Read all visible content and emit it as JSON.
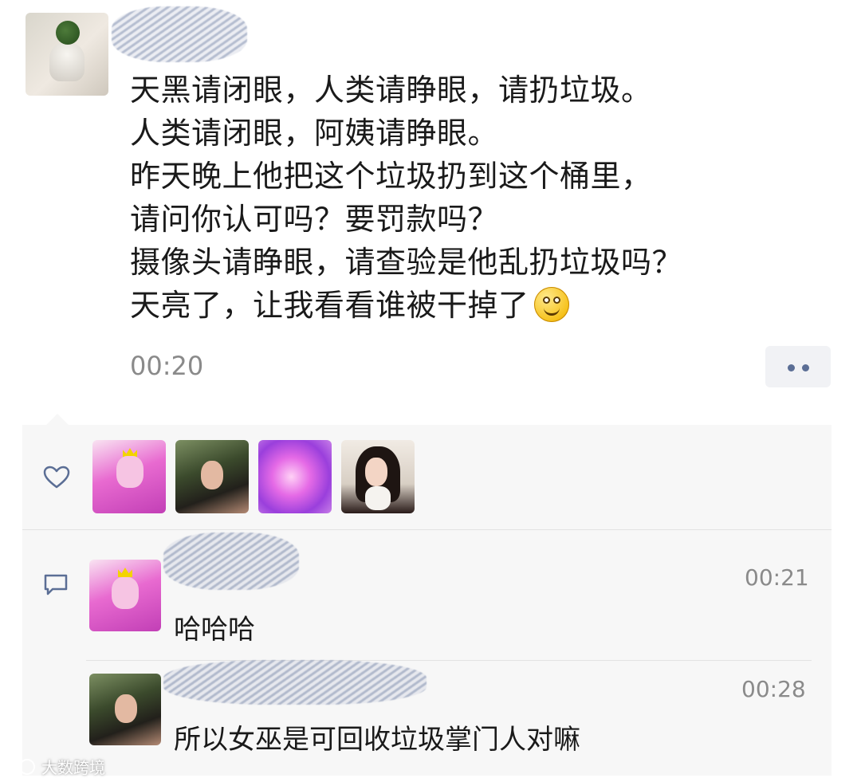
{
  "post": {
    "lines": [
      "天黑请闭眼，人类请睁眼，请扔垃圾。",
      "人类请闭眼，阿姨请睁眼。",
      "昨天晚上他把这个垃圾扔到这个桶里，",
      "请问你认可吗？要罚款吗？",
      "摄像头请睁眼，请查验是他乱扔垃圾吗？",
      "天亮了，让我看看谁被干掉了"
    ],
    "emoji": "smiley-emoji",
    "time": "00:20"
  },
  "likes": {
    "icon": "heart-icon",
    "avatars": [
      "princess-bubblegum-avatar",
      "woman-avatar",
      "pink-blur-avatar",
      "girl-with-cat-avatar"
    ]
  },
  "comments": [
    {
      "text": "哈哈哈",
      "time": "00:21"
    },
    {
      "text": "所以女巫是可回收垃圾掌门人对嘛",
      "time": "00:28"
    }
  ],
  "comments_icon": "comment-icon",
  "more_icon": "more-dots-icon",
  "watermark": {
    "text": "大数跨境"
  }
}
